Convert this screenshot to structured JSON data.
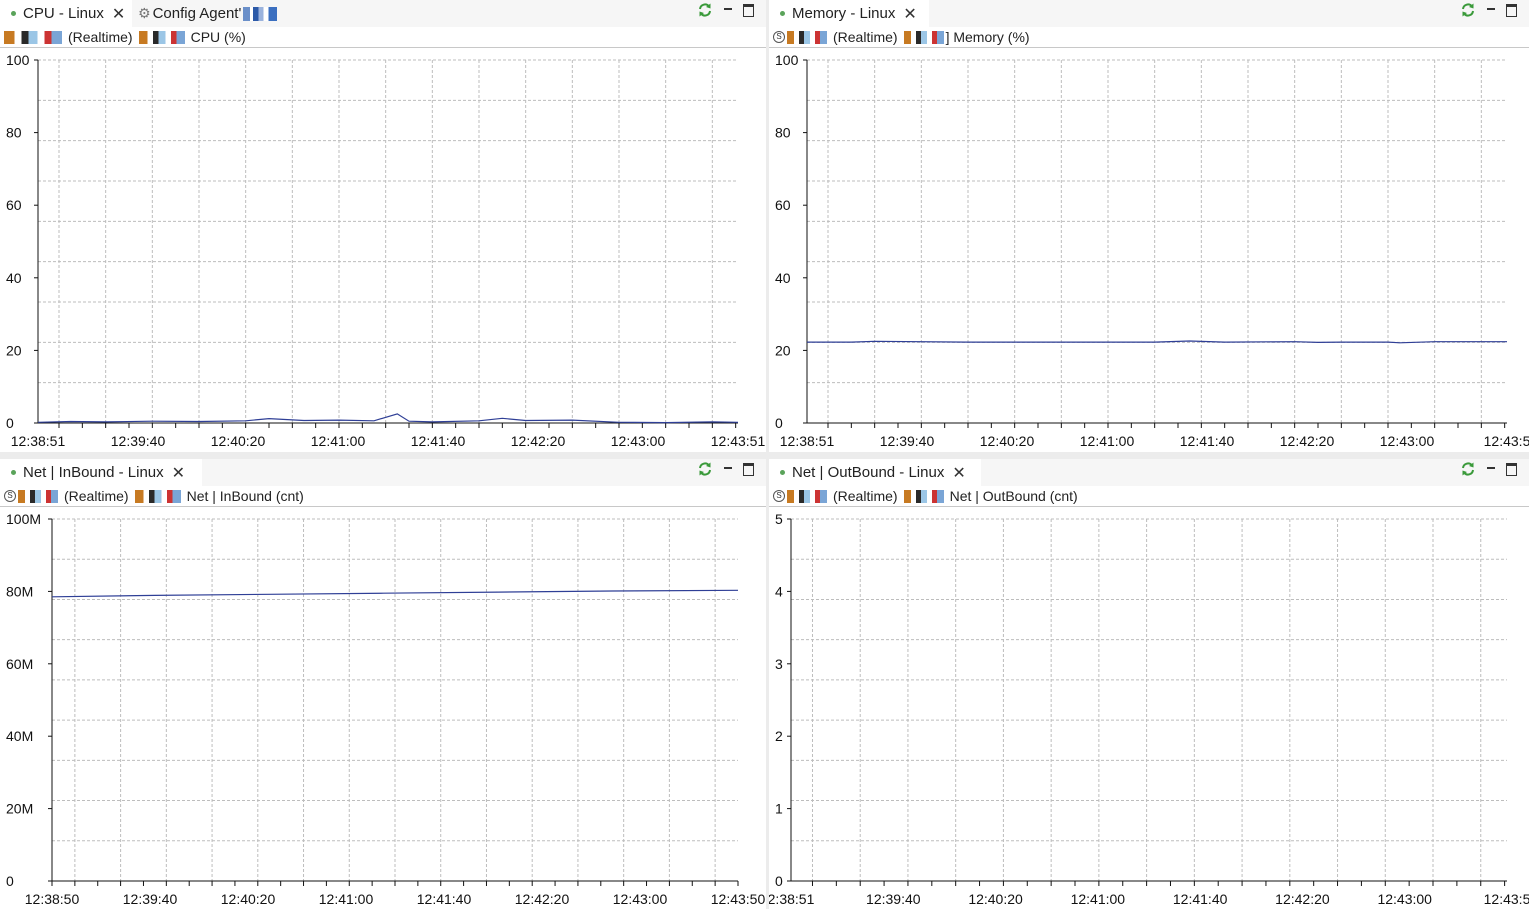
{
  "panes": [
    {
      "id": "cpu",
      "tabs": [
        {
          "label": "CPU - Linux",
          "active": true,
          "closable": true
        },
        {
          "label": "Config Agent'",
          "active": false,
          "closable": false
        }
      ],
      "subtitle": {
        "mode": "(Realtime)",
        "metric": "CPU (%)"
      },
      "chart_data": {
        "type": "line",
        "y_ticks": [
          "100",
          "80",
          "60",
          "40",
          "20",
          "0"
        ],
        "ylim": [
          0,
          100
        ],
        "x_ticks": [
          "12:38:51",
          "12:39:40",
          "12:40:20",
          "12:41:00",
          "12:41:40",
          "12:42:20",
          "12:43:00",
          "12:43:51"
        ],
        "xlim": [
          "12:38:51",
          "12:43:51"
        ],
        "series": [
          {
            "color": "#2f3f96",
            "x": [
              "12:38:51",
              "12:39:05",
              "12:39:20",
              "12:39:40",
              "12:40:00",
              "12:40:20",
              "12:40:30",
              "12:40:45",
              "12:41:00",
              "12:41:15",
              "12:41:25",
              "12:41:30",
              "12:41:40",
              "12:42:00",
              "12:42:10",
              "12:42:20",
              "12:42:40",
              "12:43:00",
              "12:43:20",
              "12:43:40",
              "12:43:51"
            ],
            "y": [
              0.2,
              0.4,
              0.3,
              0.5,
              0.4,
              0.6,
              1.2,
              0.7,
              0.8,
              0.6,
              2.5,
              0.5,
              0.3,
              0.6,
              1.3,
              0.7,
              0.8,
              0.2,
              0.1,
              0.3,
              0.2
            ]
          }
        ]
      }
    },
    {
      "id": "memory",
      "tabs": [
        {
          "label": "Memory - Linux",
          "active": true,
          "closable": true
        }
      ],
      "subtitle": {
        "mode": "(Realtime)",
        "metric": "] Memory (%)"
      },
      "chart_data": {
        "type": "line",
        "y_ticks": [
          "100",
          "80",
          "60",
          "40",
          "20",
          "0"
        ],
        "ylim": [
          0,
          100
        ],
        "x_ticks": [
          "12:38:51",
          "12:39:40",
          "12:40:20",
          "12:41:00",
          "12:41:40",
          "12:42:20",
          "12:43:00",
          "12:43:5"
        ],
        "xlim": [
          "12:38:51",
          "12:43:51"
        ],
        "series": [
          {
            "color": "#2f3f96",
            "x": [
              "12:38:51",
              "12:39:10",
              "12:39:20",
              "12:40:00",
              "12:40:40",
              "12:41:20",
              "12:41:35",
              "12:41:50",
              "12:42:20",
              "12:42:30",
              "12:42:40",
              "12:43:00",
              "12:43:05",
              "12:43:20",
              "12:43:51"
            ],
            "y": [
              22.3,
              22.3,
              22.5,
              22.3,
              22.3,
              22.3,
              22.6,
              22.3,
              22.4,
              22.2,
              22.3,
              22.3,
              22.1,
              22.4,
              22.4
            ]
          }
        ]
      }
    },
    {
      "id": "net-inbound",
      "tabs": [
        {
          "label": "Net | InBound - Linux",
          "active": true,
          "closable": true
        }
      ],
      "subtitle": {
        "mode": "(Realtime)",
        "metric": "Net | InBound (cnt)"
      },
      "chart_data": {
        "type": "line",
        "y_ticks": [
          "100M",
          "80M",
          "60M",
          "40M",
          "20M",
          "0"
        ],
        "ylim": [
          0,
          100000000
        ],
        "x_ticks": [
          "12:38:50",
          "12:39:40",
          "12:40:20",
          "12:41:00",
          "12:41:40",
          "12:42:20",
          "12:43:00",
          "12:43:50"
        ],
        "xlim": [
          "12:38:50",
          "12:43:50"
        ],
        "series": [
          {
            "color": "#2f3f96",
            "x": [
              "12:38:50",
              "12:39:35",
              "12:40:25",
              "12:41:15",
              "12:42:05",
              "12:42:55",
              "12:43:50"
            ],
            "y": [
              78500000,
              78900000,
              79200000,
              79500000,
              79800000,
              80100000,
              80300000
            ]
          }
        ]
      }
    },
    {
      "id": "net-outbound",
      "tabs": [
        {
          "label": "Net | OutBound - Linux",
          "active": true,
          "closable": true
        }
      ],
      "subtitle": {
        "mode": "(Realtime)",
        "metric": "Net | OutBound (cnt)"
      },
      "chart_data": {
        "type": "line",
        "y_ticks": [
          "5",
          "4",
          "3",
          "2",
          "1",
          "0"
        ],
        "ylim": [
          0,
          5
        ],
        "x_ticks": [
          "2:38:51",
          "12:39:40",
          "12:40:20",
          "12:41:00",
          "12:41:40",
          "12:42:20",
          "12:43:00",
          "12:43:5"
        ],
        "xlim": [
          "12:38:51",
          "12:43:51"
        ],
        "series": []
      }
    }
  ]
}
